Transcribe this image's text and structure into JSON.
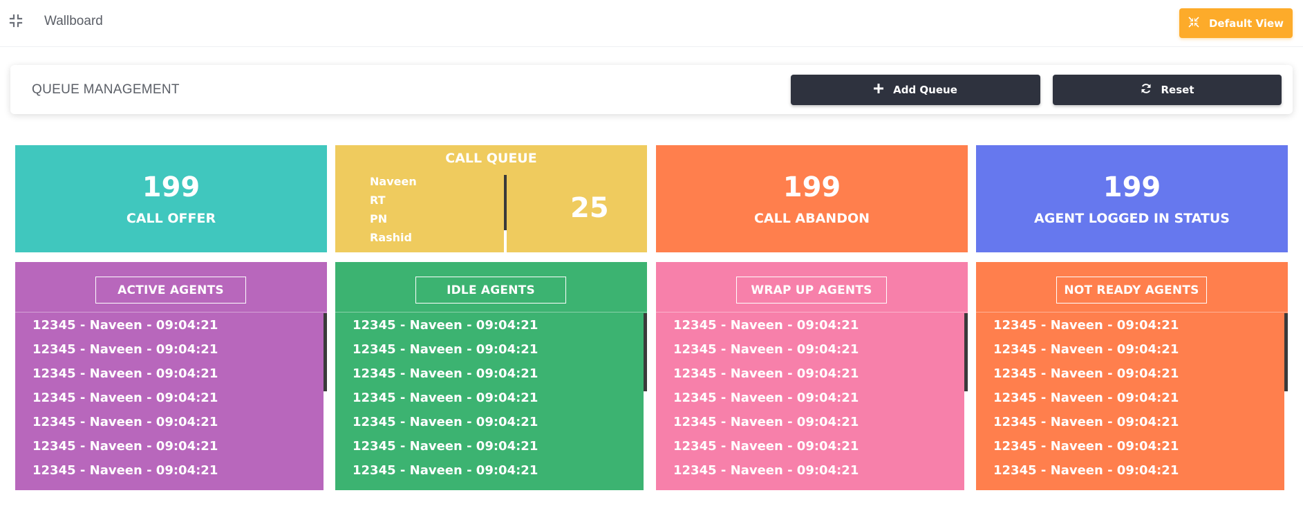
{
  "header": {
    "title": "Wallboard",
    "collapse_icon": "collapse-arrows-icon",
    "default_view_label": "Default View",
    "default_view_icon": "compress-icon",
    "accent_color": "#fdab2a"
  },
  "queue_management": {
    "title": "QUEUE MANAGEMENT",
    "add_queue_label": "Add Queue",
    "add_queue_icon": "plus-icon",
    "reset_label": "Reset",
    "reset_icon": "refresh-icon"
  },
  "stats": {
    "call_offer": {
      "value": "199",
      "label": "CALL OFFER",
      "color": "#40c7be"
    },
    "call_queue": {
      "title": "CALL QUEUE",
      "names": [
        "Naveen",
        "RT",
        "PN",
        "Rashid"
      ],
      "count": "25",
      "color": "#efcb5e"
    },
    "call_abandon": {
      "value": "199",
      "label": "CALL ABANDON",
      "color": "#ff7f4d"
    },
    "agent_logged_in": {
      "value": "199",
      "label": "AGENT LOGGED IN STATUS",
      "color": "#6678ee"
    }
  },
  "panels": {
    "active": {
      "title": "ACTIVE AGENTS",
      "color": "#b867bc",
      "rows": [
        "12345 - Naveen - 09:04:21",
        "12345 - Naveen - 09:04:21",
        "12345 - Naveen - 09:04:21",
        "12345 - Naveen - 09:04:21",
        "12345 - Naveen - 09:04:21",
        "12345 - Naveen - 09:04:21",
        "12345 - Naveen - 09:04:21"
      ]
    },
    "idle": {
      "title": "IDLE AGENTS",
      "color": "#3cb371",
      "rows": [
        "12345 - Naveen - 09:04:21",
        "12345 - Naveen - 09:04:21",
        "12345 - Naveen - 09:04:21",
        "12345 - Naveen - 09:04:21",
        "12345 - Naveen - 09:04:21",
        "12345 - Naveen - 09:04:21",
        "12345 - Naveen - 09:04:21"
      ]
    },
    "wrap_up": {
      "title": "WRAP UP AGENTS",
      "color": "#f780aa",
      "rows": [
        "12345 - Naveen - 09:04:21",
        "12345 - Naveen - 09:04:21",
        "12345 - Naveen - 09:04:21",
        "12345 - Naveen - 09:04:21",
        "12345 - Naveen - 09:04:21",
        "12345 - Naveen - 09:04:21",
        "12345 - Naveen - 09:04:21"
      ]
    },
    "not_ready": {
      "title": "NOT READY AGENTS",
      "color": "#ff7f4d",
      "rows": [
        "12345 - Naveen - 09:04:21",
        "12345 - Naveen - 09:04:21",
        "12345 - Naveen - 09:04:21",
        "12345 - Naveen - 09:04:21",
        "12345 - Naveen - 09:04:21",
        "12345 - Naveen - 09:04:21",
        "12345 - Naveen - 09:04:21"
      ]
    }
  }
}
